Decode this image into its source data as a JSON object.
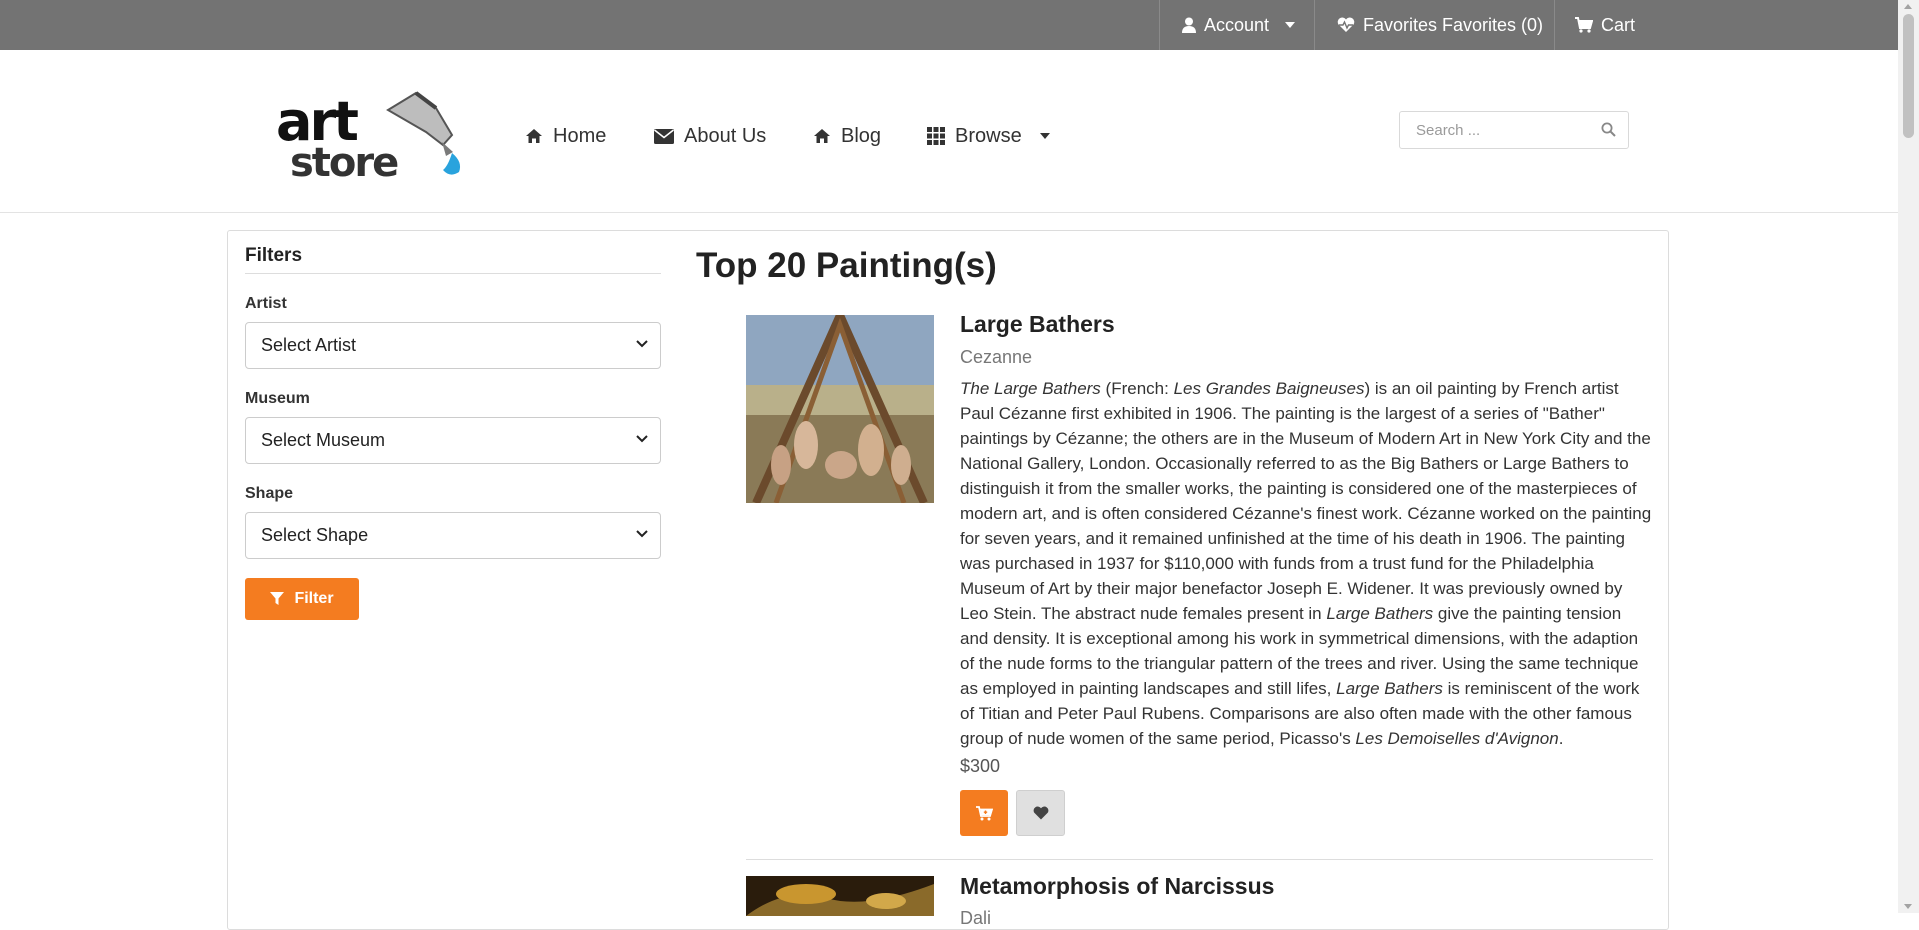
{
  "topbar": {
    "account_label": "Account",
    "favorites_label": "Favorites Favorites (0)",
    "cart_label": "Cart"
  },
  "nav": {
    "home": "Home",
    "about": "About Us",
    "blog": "Blog",
    "browse": "Browse"
  },
  "search": {
    "placeholder": "Search ..."
  },
  "filters": {
    "title": "Filters",
    "artist_label": "Artist",
    "artist_value": "Select Artist",
    "museum_label": "Museum",
    "museum_value": "Select Museum",
    "shape_label": "Shape",
    "shape_value": "Select Shape",
    "button_label": "Filter"
  },
  "results": {
    "title": "Top 20 Painting(s)",
    "items": [
      {
        "title": "Large Bathers",
        "artist": "Cezanne",
        "desc_segments": [
          "The Large Bathers",
          " (French: ",
          "Les Grandes Baigneuses",
          ") is an oil painting by French artist Paul Cézanne first exhibited in 1906. The painting is the largest of a series of \"Bather\" paintings by Cézanne; the others are in the Museum of Modern Art in New York City and the National Gallery, London. Occasionally referred to as the Big Bathers or Large Bathers to distinguish it from the smaller works, the painting is considered one of the masterpieces of modern art, and is often considered Cézanne's finest work. Cézanne worked on the painting for seven years, and it remained unfinished at the time of his death in 1906. The painting was purchased in 1937 for $110,000 with funds from a trust fund for the Philadelphia Museum of Art by their major benefactor Joseph E. Widener. It was previously owned by Leo Stein. The abstract nude females present in ",
          "Large Bathers",
          " give the painting tension and density. It is exceptional among his work in symmetrical dimensions, with the adaption of the nude forms to the triangular pattern of the trees and river. Using the same technique as employed in painting landscapes and still lifes, ",
          "Large Bathers",
          " is reminiscent of the work of Titian and Peter Paul Rubens. Comparisons are also often made with the other famous group of nude women of the same period, Picasso's ",
          "Les Demoiselles d'Avignon",
          "."
        ],
        "price": "$300"
      },
      {
        "title": "Metamorphosis of Narcissus",
        "artist": "Dali"
      }
    ]
  },
  "colors": {
    "accent": "#f47c20",
    "topbar": "#737373"
  }
}
